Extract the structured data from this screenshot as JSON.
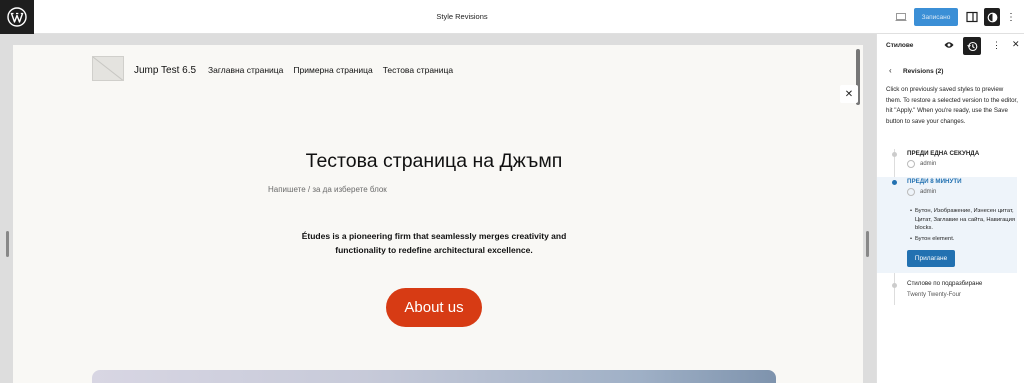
{
  "topbar": {
    "document_title": "Style Revisions",
    "save_label": "Записано"
  },
  "site": {
    "title": "Jump Test 6.5",
    "nav": [
      "Заглавна страница",
      "Примерна страница",
      "Тестова страница"
    ],
    "page_heading": "Тестова страница на Джъмп",
    "block_placeholder": "Напишете / за да изберете блок",
    "tagline_line1": "Études is a pioneering firm that seamlessly merges creativity and",
    "tagline_line2": "functionality to redefine architectural excellence.",
    "cta_label": "About us"
  },
  "sidebar": {
    "title": "Стилове",
    "revisions_heading": "Revisions (2)",
    "description": "Click on previously saved styles to preview them. To restore a selected version to the editor, hit \"Apply.\" When you're ready, use the Save button to save your changes.",
    "revisions": [
      {
        "date": "ПРЕДИ ЕДНА СЕКУНДА",
        "author": "admin"
      },
      {
        "date": "ПРЕДИ 8 МИНУТИ",
        "author": "admin",
        "changes": [
          "Бутон, Изображение, Изнесен цитат, Цитат, Заглавие на сайта, Навигация blocks.",
          "Бутон element."
        ],
        "apply_label": "Прилагане"
      }
    ],
    "default": {
      "name": "Стилове по подразбиране",
      "theme": "Twenty Twenty-Four"
    }
  },
  "colors": {
    "accent": "#2271b1",
    "cta": "#d73b14",
    "save": "#3b8fd6"
  }
}
